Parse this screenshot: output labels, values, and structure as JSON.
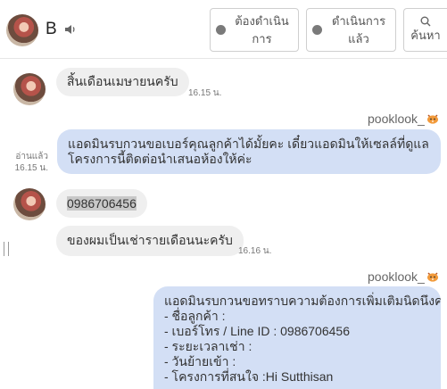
{
  "header": {
    "contact_name": "B",
    "buttons": {
      "todo_label": "ต้องดำเนินการ",
      "done_label": "ดำเนินการแล้ว",
      "search_label": "ค้นหา"
    }
  },
  "messages": [
    {
      "direction": "in",
      "text": "สิ้นเดือนเมษายนครับ",
      "time": "16.15 น."
    },
    {
      "direction": "out",
      "sender": "pooklook_",
      "read_label": "อ่านแล้ว",
      "time": "16.15 น.",
      "lines": [
        "แอดมินรบกวนขอเบอร์คุณลูกค้าได้มั้ยคะ เดี๋ยวแอดมินให้เซลล์ที่ดูแล",
        "โครงการนี้ติดต่อนำเสนอห้องให้ค่ะ"
      ]
    },
    {
      "direction": "in",
      "text": "0986706456"
    },
    {
      "direction": "in",
      "text": "ของผมเป็นเช่ารายเดือนนะครับ",
      "time": "16.16 น."
    },
    {
      "direction": "out",
      "sender": "pooklook_",
      "lines": [
        "แอดมินรบกวนขอทราบความต้องการเพิ่มเติมนิดนึงค่ะ",
        "- ชื่อลูกค้า :",
        "- เบอร์โทร / Line ID : 0986706456",
        "- ระยะเวลาเช่า :",
        "- วันย้ายเข้า :",
        "- โครงการที่สนใจ :Hi Sutthisan"
      ]
    }
  ]
}
